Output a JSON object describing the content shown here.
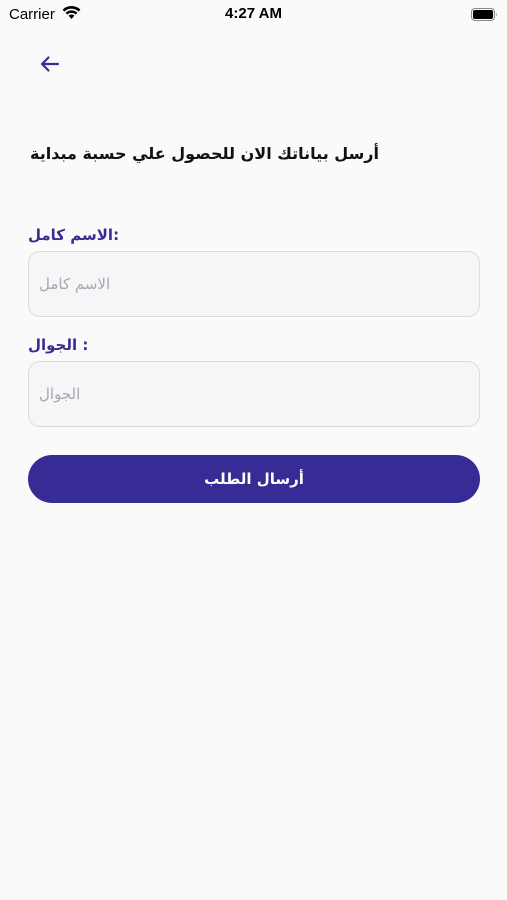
{
  "status_bar": {
    "carrier": "Carrier",
    "time": "4:27 AM",
    "wifi_icon": "wifi-icon",
    "battery_icon": "battery-icon"
  },
  "nav": {
    "back_icon": "arrow-left-icon"
  },
  "heading": "أرسل بياناتك الان للحصول علي حسبة مبداية",
  "form": {
    "name_label": ":الاسم كامل",
    "name_placeholder": "الاسم كامل",
    "name_value": "",
    "phone_label": ": الجوال",
    "phone_placeholder": "الجوال",
    "phone_value": "",
    "submit_label": "أرسال الطلب"
  },
  "colors": {
    "accent": "#372b95",
    "label": "#3a2d92",
    "background": "#fafafa",
    "input_bg": "#f6f6f8",
    "input_border": "#dcdcdf"
  }
}
